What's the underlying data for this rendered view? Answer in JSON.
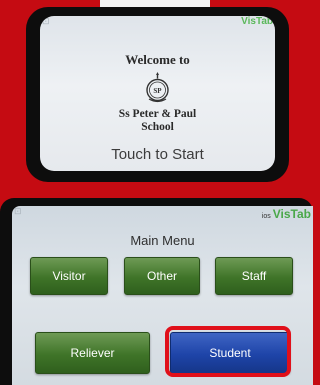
{
  "welcome_screen": {
    "heading": "Welcome to",
    "school_line1": "Ss Peter & Paul",
    "school_line2": "School",
    "crest_text": "SP",
    "prompt": "Touch to Start",
    "brand": "VisTab"
  },
  "main_menu": {
    "title": "Main Menu",
    "brand_prefix": "ios",
    "brand": "VisTab",
    "buttons": {
      "visitor": "Visitor",
      "other": "Other",
      "staff": "Staff",
      "reliever": "Reliever",
      "student": "Student"
    }
  },
  "colors": {
    "background_red": "#c50b12",
    "button_green": "#3f7428",
    "button_blue": "#1e44a8",
    "highlight_red": "#e0101a",
    "brand_green": "#4aa84a"
  }
}
